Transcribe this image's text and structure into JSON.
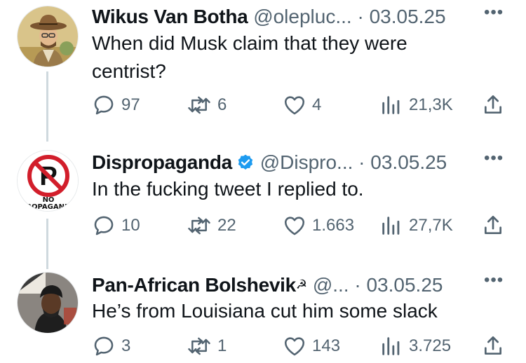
{
  "tweets": [
    {
      "name": "Wikus Van Botha",
      "handle": "@olepluc...",
      "separator": "·",
      "date": "03.05.25",
      "text": "When did Musk claim that they were centrist?",
      "avatar": "cowboy-illustration-avatar",
      "stats": {
        "replies": "97",
        "reposts": "6",
        "likes": "4",
        "views": "21,3K"
      }
    },
    {
      "name": "Dispropaganda",
      "verified": true,
      "handle": "@Dispro...",
      "separator": "·",
      "date": "03.05.25",
      "text": "In the fucking tweet I replied to.",
      "avatar": "no-propaganda-sign-avatar",
      "avatar_text": "NO PROPAGANDA",
      "stats": {
        "replies": "10",
        "reposts": "22",
        "likes": "1.663",
        "views": "27,7K"
      }
    },
    {
      "name": "Pan-African Bolshevik",
      "name_emoji": "☭",
      "handle": "@...",
      "separator": "·",
      "date": "03.05.25",
      "text": "He’s from Louisiana cut him some slack",
      "avatar": "protester-photo-avatar",
      "stats": {
        "replies": "3",
        "reposts": "1",
        "likes": "143",
        "views": "3.725"
      }
    }
  ],
  "menu_label": "•••",
  "colors": {
    "text": "#0f1419",
    "secondary": "#536471",
    "verified": "#1d9bf0",
    "thread_line": "#cfd9de"
  }
}
